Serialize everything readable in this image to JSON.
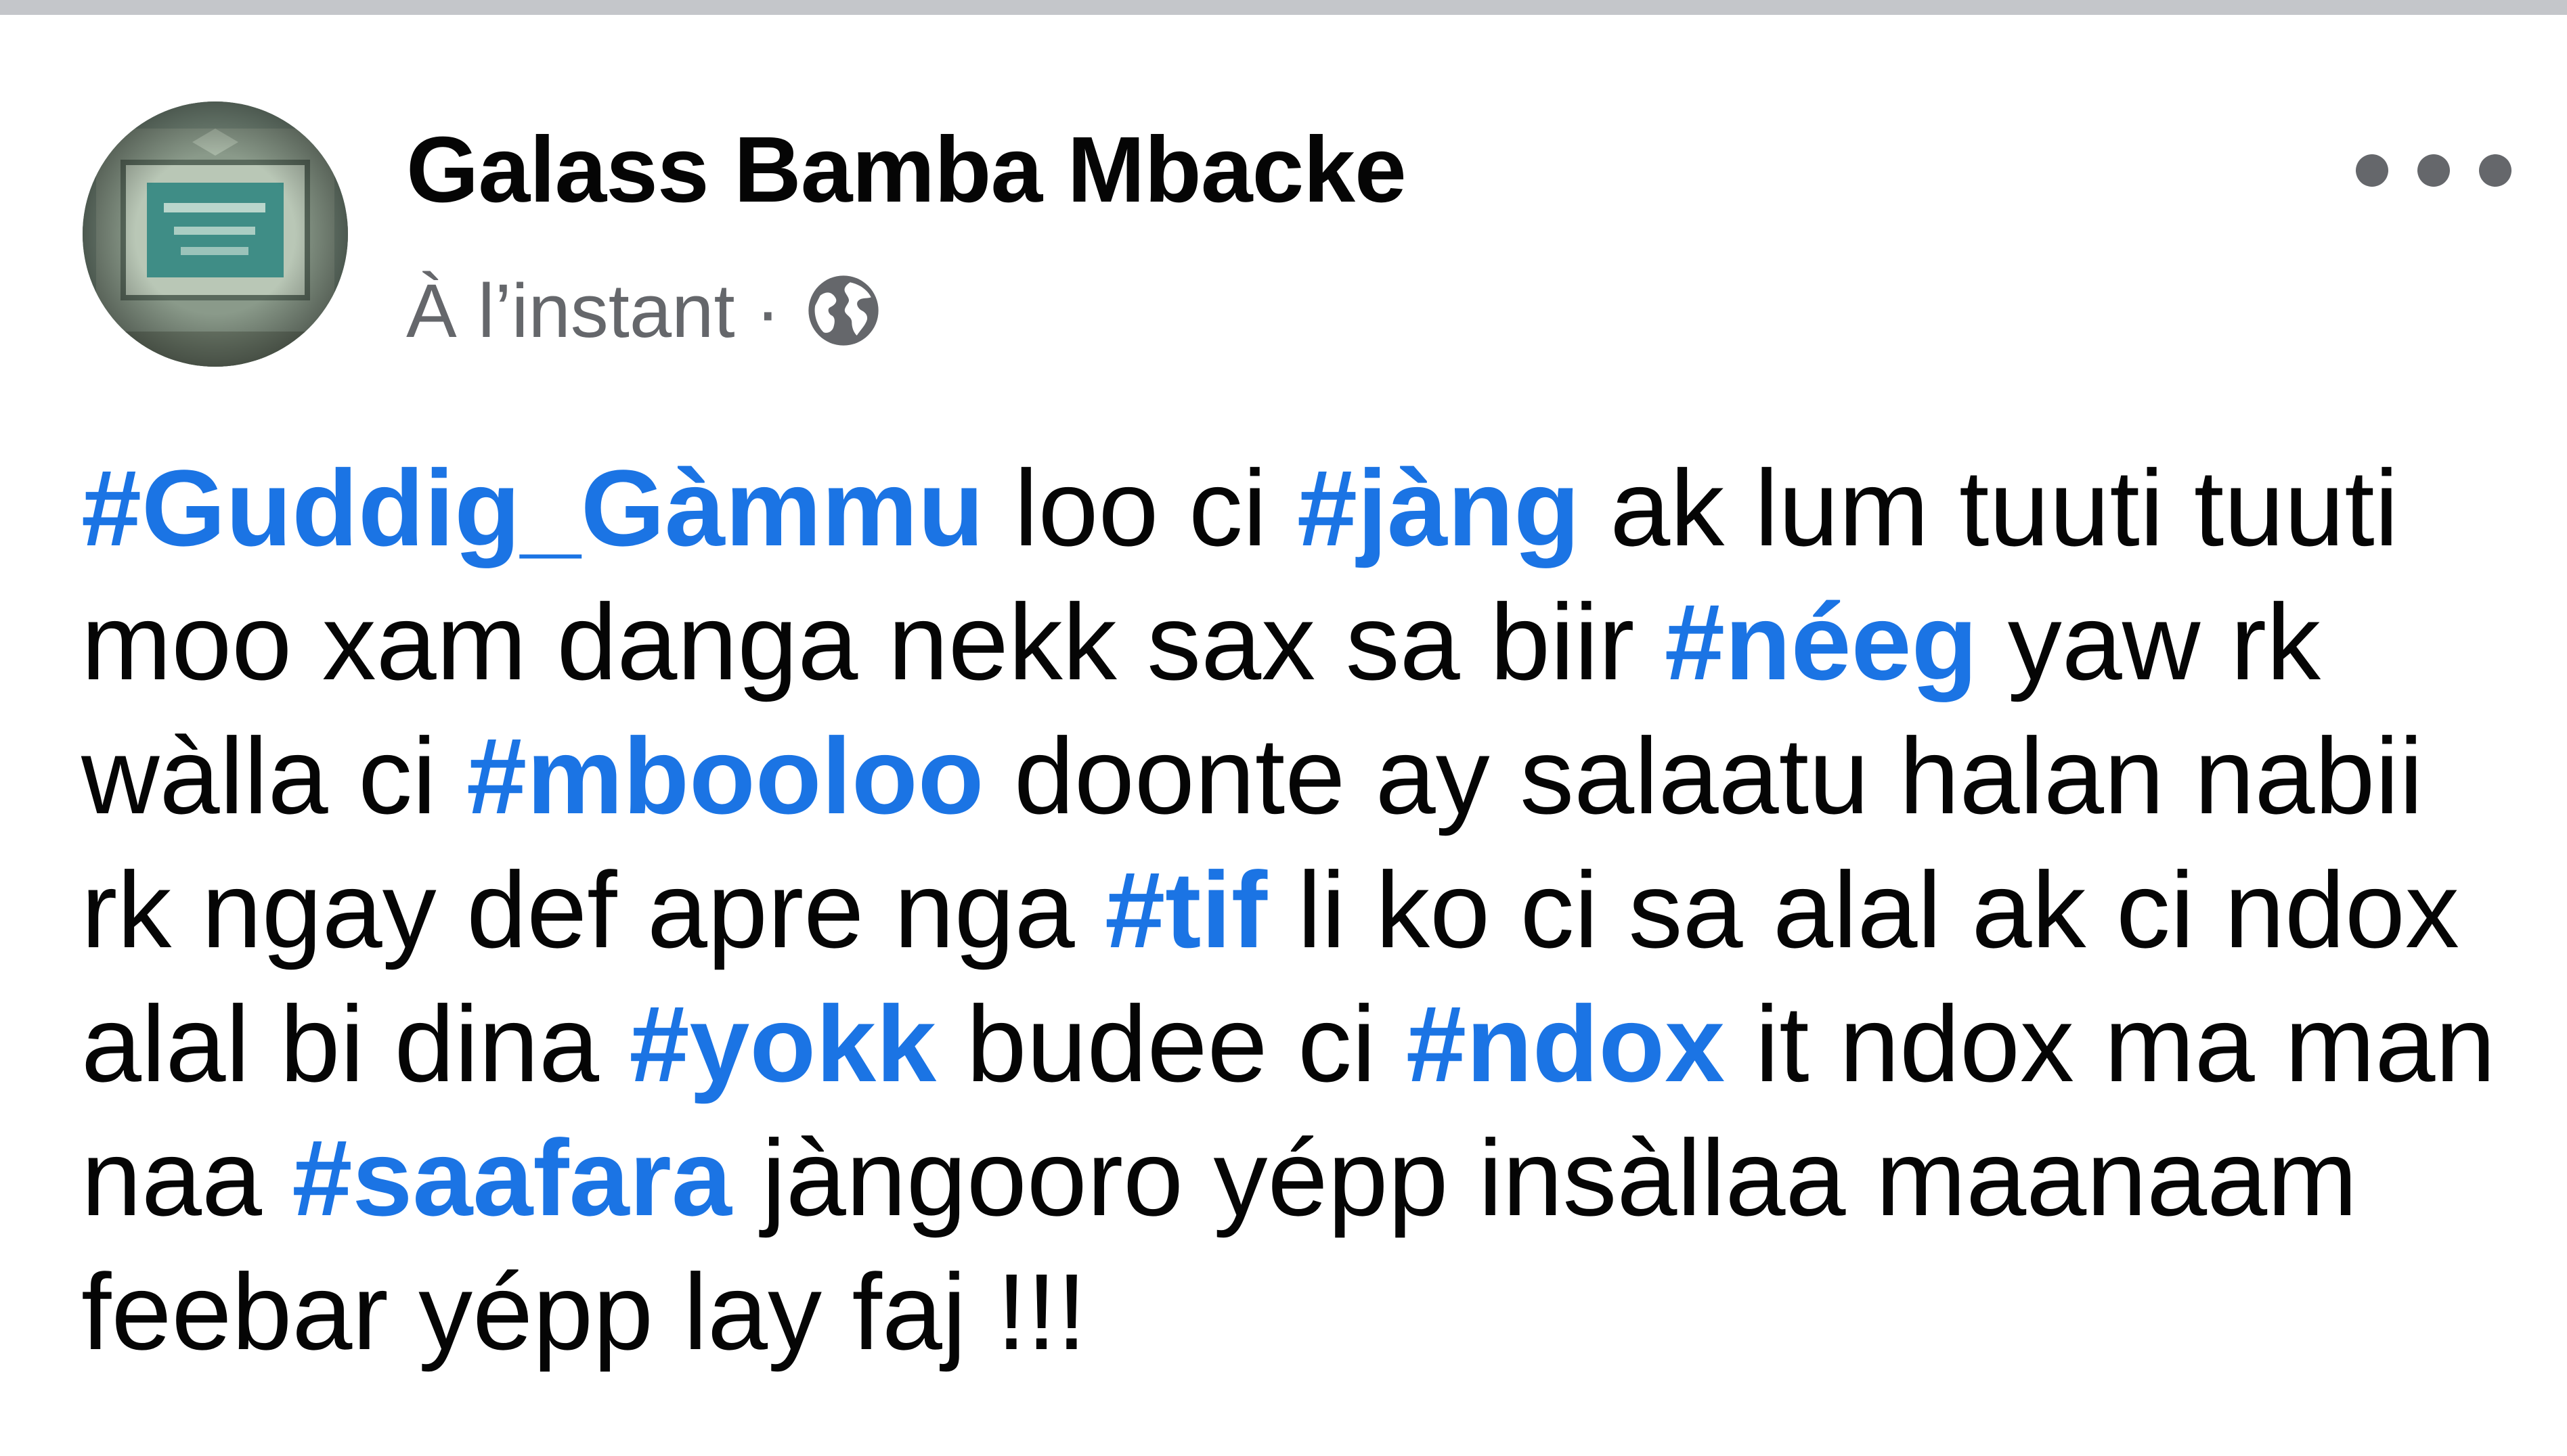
{
  "post": {
    "author": "Galass Bamba Mbacke",
    "timestamp": "À l’instant",
    "separator": "·",
    "audience_icon": "globe-icon",
    "more_icon": "more-options-icon",
    "body": [
      {
        "type": "hashtag",
        "text": "#Guddig_Gàmmu"
      },
      {
        "type": "text",
        "text": " loo ci "
      },
      {
        "type": "hashtag",
        "text": "#jàng"
      },
      {
        "type": "text",
        "text": " ak lum tuuti tuuti moo xam danga nekk sax sa biir "
      },
      {
        "type": "hashtag",
        "text": "#néeg"
      },
      {
        "type": "text",
        "text": " yaw rk wàlla ci "
      },
      {
        "type": "hashtag",
        "text": "#mbooloo"
      },
      {
        "type": "text",
        "text": " doonte ay salaatu halan nabii rk ngay def apre nga "
      },
      {
        "type": "hashtag",
        "text": "#tif"
      },
      {
        "type": "text",
        "text": " li ko ci sa alal ak ci ndox alal bi dina "
      },
      {
        "type": "hashtag",
        "text": "#yokk"
      },
      {
        "type": "text",
        "text": " budee ci "
      },
      {
        "type": "hashtag",
        "text": "#ndox"
      },
      {
        "type": "text",
        "text": " it ndox ma man naa "
      },
      {
        "type": "hashtag",
        "text": "#saafara"
      },
      {
        "type": "text",
        "text": " jàngooro yépp insàllaa maanaam feebar yépp lay faj !!!"
      }
    ]
  },
  "colors": {
    "hashtag": "#1b74e4",
    "text": "#050505",
    "meta": "#65676b",
    "divider": "#c4c6ca"
  }
}
